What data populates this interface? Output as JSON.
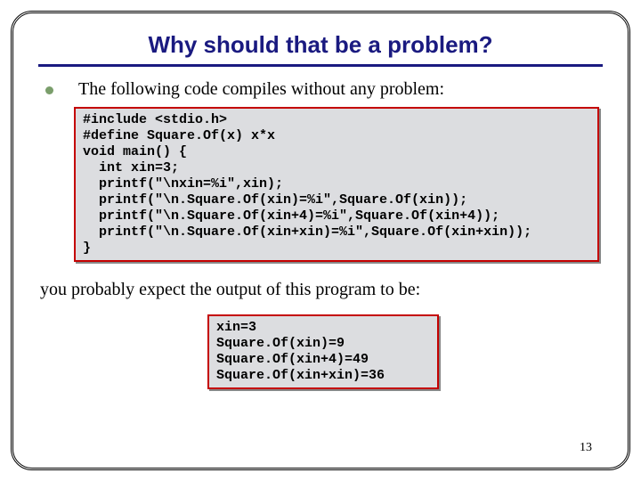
{
  "title": "Why should that be a problem?",
  "bullet": "The following code compiles without any problem:",
  "code1": "#include <stdio.h>\n#define Square.Of(x) x*x\nvoid main() {\n  int xin=3;\n  printf(\"\\nxin=%i\",xin);\n  printf(\"\\n.Square.Of(xin)=%i\",Square.Of(xin));\n  printf(\"\\n.Square.Of(xin+4)=%i\",Square.Of(xin+4));\n  printf(\"\\n.Square.Of(xin+xin)=%i\",Square.Of(xin+xin));\n}",
  "body": "you probably expect the output of this program to be:",
  "code2": "xin=3\nSquare.Of(xin)=9\nSquare.Of(xin+4)=49\nSquare.Of(xin+xin)=36",
  "page": "13"
}
